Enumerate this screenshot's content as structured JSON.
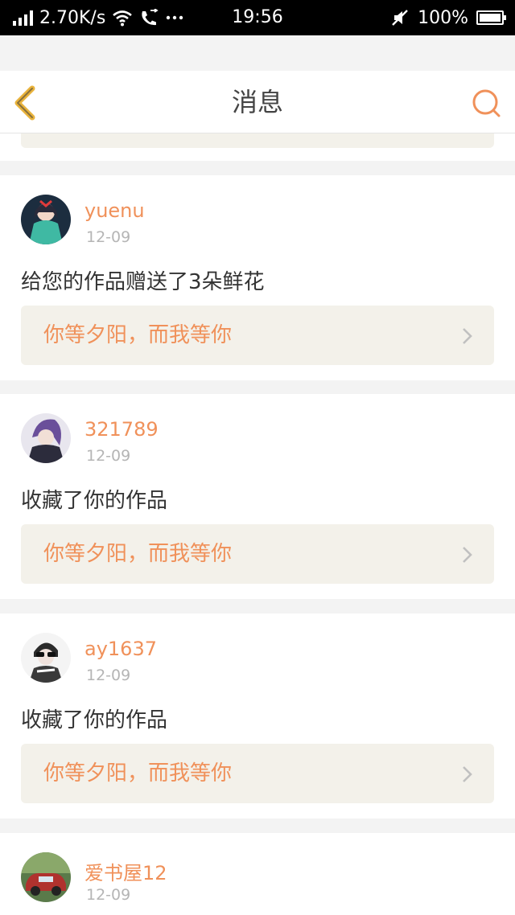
{
  "status_bar": {
    "speed": "2.70K/s",
    "time": "19:56",
    "battery": "100%",
    "icons": [
      "signal-icon",
      "wifi-icon",
      "call-icon",
      "more-icon",
      "mute-icon",
      "battery-icon"
    ]
  },
  "header": {
    "title": "消息",
    "accent_color": "#f0915a",
    "back_color": "#e9b33c"
  },
  "messages": [
    {
      "username": "yuenu",
      "date": "12-09",
      "action": "给您的作品赠送了3朵鲜花",
      "work_title": "你等夕阳，而我等你",
      "avatar_color": "#3fb9a3"
    },
    {
      "username": "321789",
      "date": "12-09",
      "action": "收藏了你的作品",
      "work_title": "你等夕阳，而我等你",
      "avatar_color": "#6a5a8a"
    },
    {
      "username": "ay1637",
      "date": "12-09",
      "action": "收藏了你的作品",
      "work_title": "你等夕阳，而我等你",
      "avatar_color": "#3a3a3a"
    },
    {
      "username": "爱书屋12",
      "date": "12-09",
      "avatar_color": "#b0322e"
    }
  ]
}
